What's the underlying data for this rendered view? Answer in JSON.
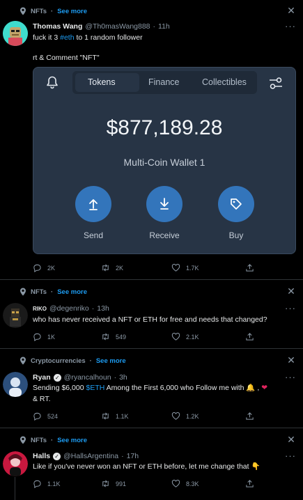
{
  "tweets": [
    {
      "context": "NFTs",
      "context_more": "See more",
      "name": "Thomas Wang",
      "handle": "@Th0masWang888",
      "time": "11h",
      "text_before": "fuck it 3 ",
      "hashtag": "#eth",
      "text_after": " to 1 random follower",
      "text_line2": "rt & Comment \"NFT\"",
      "replies": "2K",
      "retweets": "2K",
      "likes": "1.7K"
    },
    {
      "context": "NFTs",
      "context_more": "See more",
      "name": "RIKO",
      "handle": "@degenriko",
      "time": "13h",
      "text": "who has never received a NFT or ETH for free and needs that changed?",
      "replies": "1K",
      "retweets": "549",
      "likes": "2.1K"
    },
    {
      "context": "Cryptocurrencies",
      "context_more": "See more",
      "name": "Ryan",
      "handle": "@ryancalhoun",
      "time": "3h",
      "text_before": "Sending $6,000 ",
      "cashtag": "$ETH",
      "text_after": " Among the First 6,000 who Follow me with",
      "text_line2": "& RT.",
      "replies": "524",
      "retweets": "1.1K",
      "likes": "1.2K"
    },
    {
      "context": "NFTs",
      "context_more": "See more",
      "name": "Halls",
      "handle": "@HallsArgentina",
      "time": "17h",
      "text": "Like if you've never won an NFT or ETH before, let me change that",
      "replies": "1.1K",
      "retweets": "991",
      "likes": "8.3K"
    }
  ],
  "wallet": {
    "tabs": [
      "Tokens",
      "Finance",
      "Collectibles"
    ],
    "balance": "$877,189.28",
    "wallet_name": "Multi-Coin Wallet 1",
    "actions": [
      "Send",
      "Receive",
      "Buy"
    ]
  },
  "separator": "·",
  "colors": {
    "accent": "#1d9bf0",
    "wallet_button": "#3375bb",
    "card_bg": "#273445"
  }
}
